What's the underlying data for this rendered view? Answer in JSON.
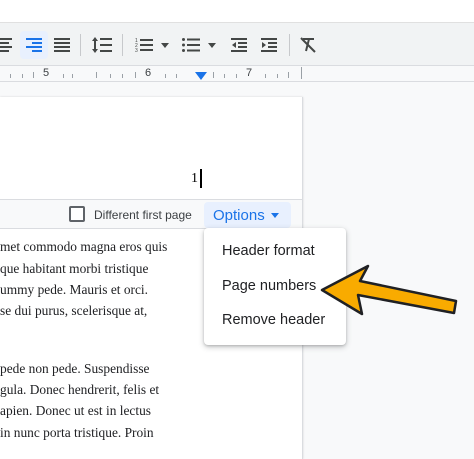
{
  "ruler": {
    "labels": [
      "5",
      "6",
      "7"
    ]
  },
  "document": {
    "header_text": "1",
    "body_lines_top": [
      "met commodo magna eros quis",
      "que habitant morbi tristique",
      "ummy pede. Mauris et orci.",
      "se dui purus, scelerisque at,"
    ],
    "body_lines_bottom": [
      "pede non pede. Suspendisse",
      "gula. Donec hendrerit, felis et",
      "apien. Donec ut est in lectus",
      "in nunc porta tristique. Proin"
    ]
  },
  "header_bar": {
    "checkbox_label": "Different first page",
    "checkbox_checked": false,
    "options_label": "Options"
  },
  "options_menu": {
    "items": [
      "Header format",
      "Page numbers",
      "Remove header"
    ]
  },
  "toolbar": {
    "icons": [
      "align-center-icon",
      "align-right-icon",
      "justify-icon",
      "line-spacing-icon",
      "numbered-list-icon",
      "numbered-list-dropdown-icon",
      "bulleted-list-icon",
      "bulleted-list-dropdown-icon",
      "decrease-indent-icon",
      "increase-indent-icon",
      "clear-formatting-icon"
    ]
  },
  "colors": {
    "accent": "#1a73e8",
    "arrow": "#f9ab00"
  }
}
